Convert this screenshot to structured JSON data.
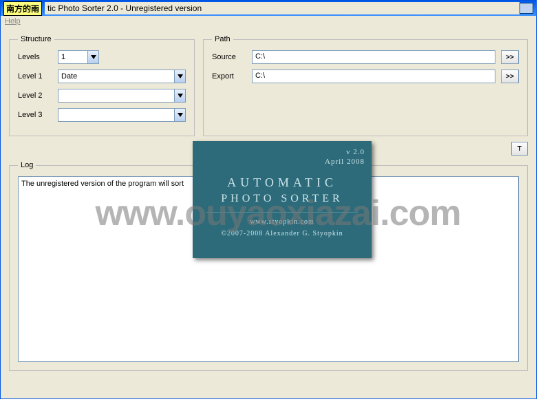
{
  "titlebar": {
    "badge": "南方的雨",
    "title": "tic Photo Sorter 2.0 - Unregistered version"
  },
  "menu": {
    "help": "Help"
  },
  "structure": {
    "legend": "Structure",
    "levels_label": "Levels",
    "levels_value": "1",
    "level1_label": "Level 1",
    "level1_value": "Date",
    "level2_label": "Level 2",
    "level2_value": "",
    "level3_label": "Level 3",
    "level3_value": ""
  },
  "path": {
    "legend": "Path",
    "source_label": "Source",
    "source_value": "C:\\",
    "export_label": "Export",
    "export_value": "C:\\"
  },
  "log": {
    "legend": "Log",
    "text": "The unregistered version of the program will sort"
  },
  "splash": {
    "version": "v 2.0",
    "date": "April 2008",
    "title1": "Automatic",
    "title2": "Photo Sorter",
    "url": "www.styopkin.com",
    "copyright": "©2007-2008 Alexander G. Styopkin"
  },
  "watermark": "www.ouyaoxiazai.com",
  "misc": {
    "partial_button": "T"
  }
}
